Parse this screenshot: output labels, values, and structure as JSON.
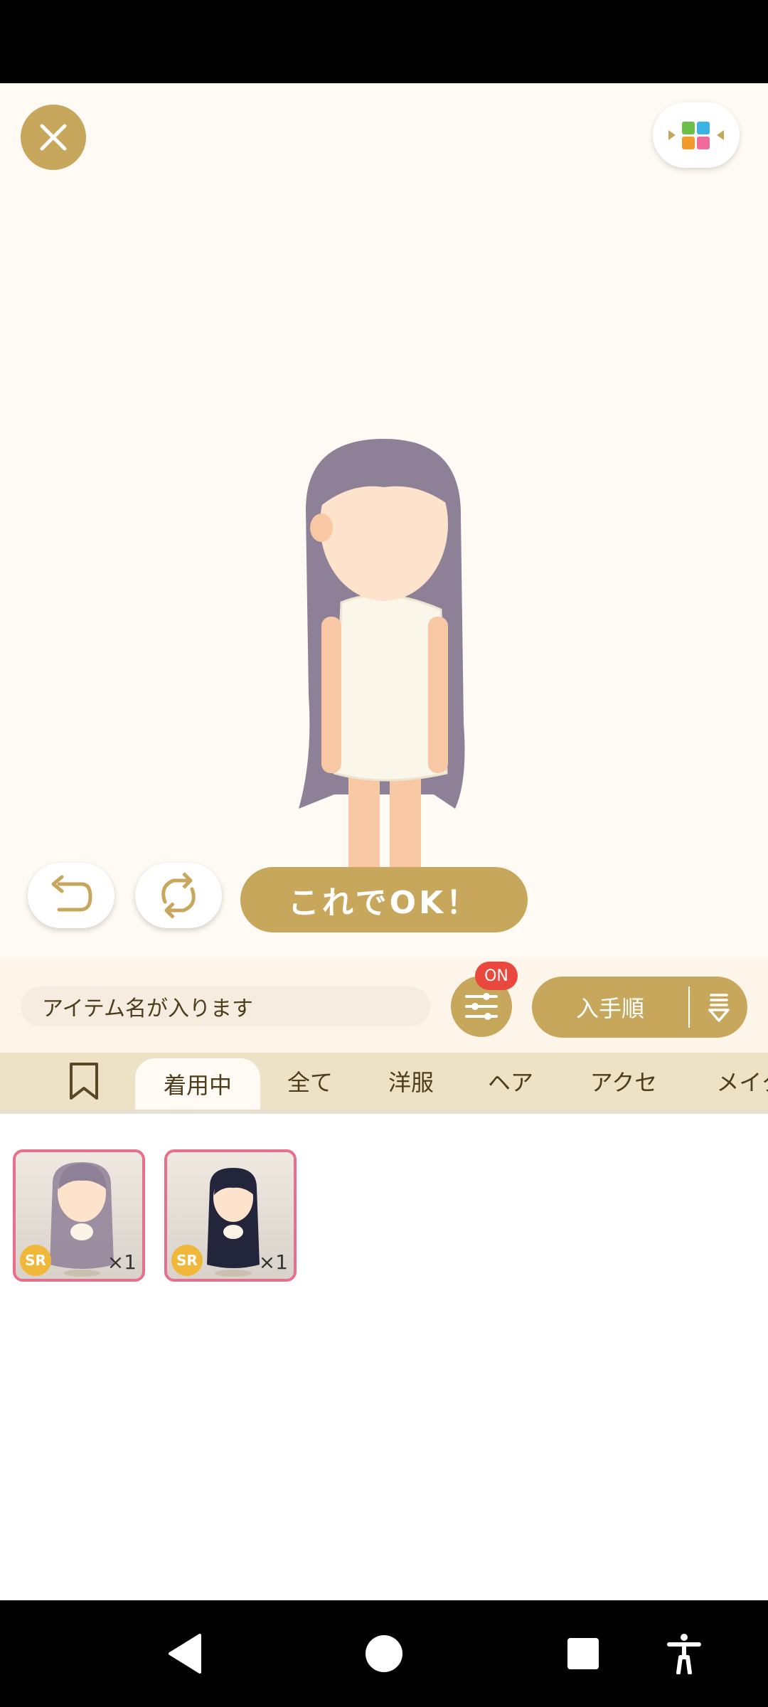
{
  "stage": {
    "ok_label": "これでOK！"
  },
  "toolbar": {
    "search_placeholder": "アイテム名が入ります",
    "filter_badge": "ON",
    "sort_label": "入手順"
  },
  "tabs": [
    "着用中",
    "全て",
    "洋服",
    "ヘア",
    "アクセ",
    "メイク"
  ],
  "active_tab": "着用中",
  "items": [
    {
      "rarity": "SR",
      "count": "×1",
      "hair_color": "#8d8097"
    },
    {
      "rarity": "SR",
      "count": "×1",
      "hair_color": "#23253a"
    }
  ],
  "colors": {
    "accent": "#c7a75c",
    "badge": "#e9483e",
    "card_border": "#e86f8c",
    "rarity": "#f0b83a"
  },
  "icons": [
    "close-icon",
    "layout-switch-icon",
    "undo-icon",
    "reset-icon",
    "filter-sliders-icon",
    "sort-icon",
    "bookmark-icon",
    "back-icon",
    "home-icon",
    "recents-icon",
    "accessibility-icon"
  ]
}
